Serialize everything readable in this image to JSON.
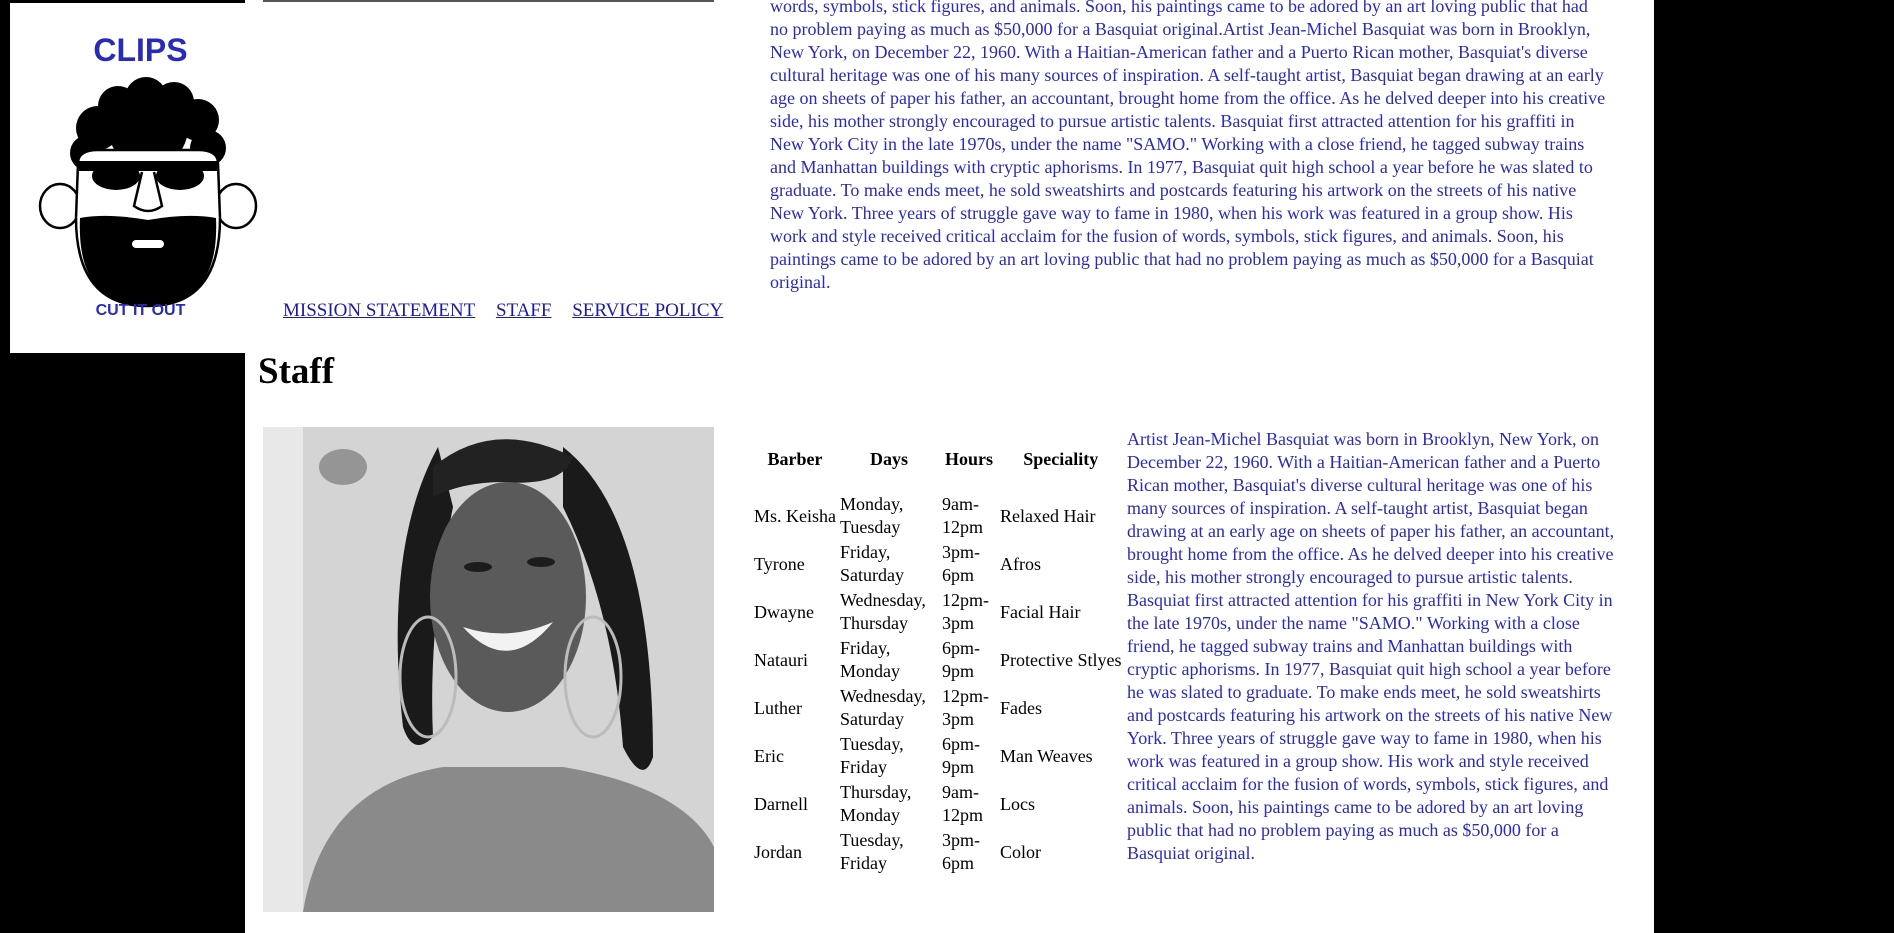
{
  "logo": {
    "title": "CLIPS",
    "tagline": "CUT IT OUT"
  },
  "nav": {
    "items": [
      {
        "label": "MISSION STATEMENT"
      },
      {
        "label": "STAFF"
      },
      {
        "label": "SERVICE POLICY"
      }
    ]
  },
  "top_paragraph": "words, symbols, stick figures, and animals. Soon, his paintings came to be adored by an art loving public that had no problem paying as much as $50,000 for a Basquiat original.Artist Jean-Michel Basquiat was born in Brooklyn, New York, on December 22, 1960. With a Haitian-American father and a Puerto Rican mother, Basquiat's diverse cultural heritage was one of his many sources of inspiration. A self-taught artist, Basquiat began drawing at an early age on sheets of paper his father, an accountant, brought home from the office. As he delved deeper into his creative side, his mother strongly encouraged to pursue artistic talents. Basquiat first attracted attention for his graffiti in New York City in the late 1970s, under the name \"SAMO.\" Working with a close friend, he tagged subway trains and Manhattan buildings with cryptic aphorisms. In 1977, Basquiat quit high school a year before he was slated to graduate. To make ends meet, he sold sweatshirts and postcards featuring his artwork on the streets of his native New York. Three years of struggle gave way to fame in 1980, when his work was featured in a group show. His work and style received critical acclaim for the fusion of words, symbols, stick figures, and animals. Soon, his paintings came to be adored by an art loving public that had no problem paying as much as $50,000 for a Basquiat original.",
  "staff": {
    "heading": "Staff",
    "columns": [
      "Barber",
      "Days",
      "Hours",
      "Speciality"
    ],
    "rows": [
      {
        "barber": "Ms. Keisha",
        "days": "Monday, Tuesday",
        "hours": "9am-12pm",
        "speciality": "Relaxed Hair"
      },
      {
        "barber": "Tyrone",
        "days": "Friday, Saturday",
        "hours": "3pm-6pm",
        "speciality": "Afros"
      },
      {
        "barber": "Dwayne",
        "days": "Wednesday, Thursday",
        "hours": "12pm-3pm",
        "speciality": "Facial Hair"
      },
      {
        "barber": "Natauri",
        "days": "Friday, Monday",
        "hours": "6pm-9pm",
        "speciality": "Protective Stlyes"
      },
      {
        "barber": "Luther",
        "days": "Wednesday, Saturday",
        "hours": "12pm-3pm",
        "speciality": "Fades"
      },
      {
        "barber": "Eric",
        "days": "Tuesday, Friday",
        "hours": "6pm-9pm",
        "speciality": "Man Weaves"
      },
      {
        "barber": "Darnell",
        "days": "Thursday, Monday",
        "hours": "9am-12pm",
        "speciality": "Locs"
      },
      {
        "barber": "Jordan",
        "days": "Tuesday, Friday",
        "hours": "3pm-6pm",
        "speciality": "Color"
      }
    ],
    "bio": "Artist Jean-Michel Basquiat was born in Brooklyn, New York, on December 22, 1960. With a Haitian-American father and a Puerto Rican mother, Basquiat's diverse cultural heritage was one of his many sources of inspiration. A self-taught artist, Basquiat began drawing at an early age on sheets of paper his father, an accountant, brought home from the office. As he delved deeper into his creative side, his mother strongly encouraged to pursue artistic talents. Basquiat first attracted attention for his graffiti in New York City in the late 1970s, under the name \"SAMO.\" Working with a close friend, he tagged subway trains and Manhattan buildings with cryptic aphorisms. In 1977, Basquiat quit high school a year before he was slated to graduate. To make ends meet, he sold sweatshirts and postcards featuring his artwork on the streets of his native New York. Three years of struggle gave way to fame in 1980, when his work was featured in a group show. His work and style received critical acclaim for the fusion of words, symbols, stick figures, and animals. Soon, his paintings came to be adored by an art loving public that had no problem paying as much as $50,000 for a Basquiat original."
  },
  "colors": {
    "background": "#000000",
    "page": "#ffffff",
    "text_accent": "#2a2ab8",
    "link": "#1a1aa6"
  }
}
